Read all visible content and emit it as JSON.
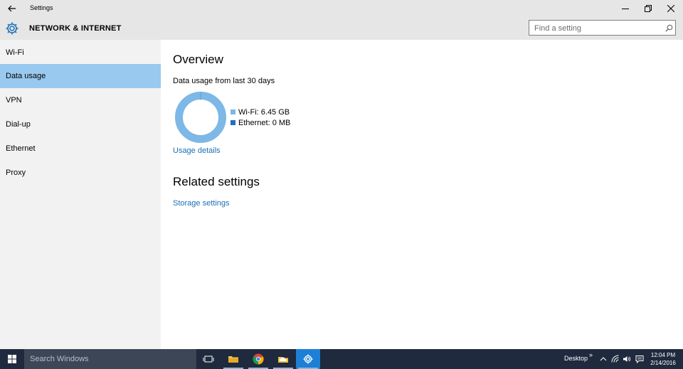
{
  "window": {
    "title": "Settings"
  },
  "header": {
    "title": "NETWORK & INTERNET",
    "search_placeholder": "Find a setting"
  },
  "sidebar": {
    "items": [
      {
        "label": "Wi-Fi",
        "active": false
      },
      {
        "label": "Data usage",
        "active": true
      },
      {
        "label": "VPN",
        "active": false
      },
      {
        "label": "Dial-up",
        "active": false
      },
      {
        "label": "Ethernet",
        "active": false
      },
      {
        "label": "Proxy",
        "active": false
      }
    ]
  },
  "main": {
    "overview_heading": "Overview",
    "period_text": "Data usage from last 30 days",
    "legend": [
      {
        "label": "Wi-Fi: 6.45 GB",
        "color": "#7db8e6",
        "value_gb": 6.45
      },
      {
        "label": "Ethernet: 0 MB",
        "color": "#1f6fc4",
        "value_gb": 0
      }
    ],
    "usage_details_link": "Usage details",
    "related_heading": "Related settings",
    "storage_link": "Storage settings"
  },
  "taskbar": {
    "search_placeholder": "Search Windows",
    "desktop_label": "Desktop",
    "chevron": "»",
    "time": "12:04 PM",
    "date": "2/14/2016",
    "icons": [
      "task-view-icon",
      "file-explorer-icon",
      "chrome-icon",
      "onedrive-folder-icon",
      "settings-icon"
    ]
  },
  "colors": {
    "accent": "#1a6fb5",
    "selection": "#99c9ef",
    "taskbar": "#1f2a3e",
    "chrome_bar": "#e6e6e6"
  }
}
